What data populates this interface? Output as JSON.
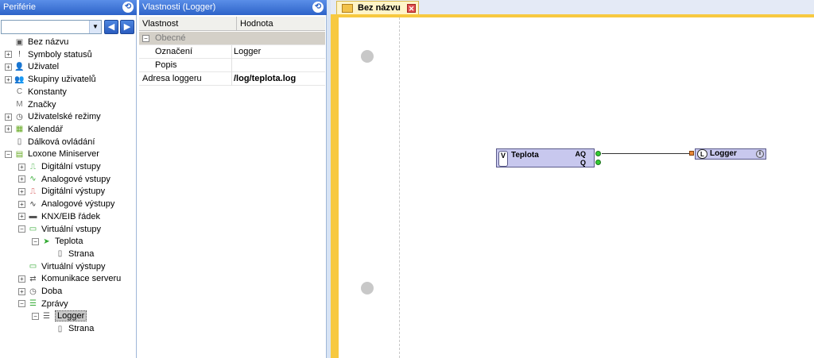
{
  "periferie": {
    "title": "Periférie",
    "tree": [
      {
        "label": "Bez názvu",
        "depth": 0,
        "expander": "",
        "icon": "page-icon",
        "glyph": "▣"
      },
      {
        "label": "Symboly statusů",
        "depth": 0,
        "expander": "+",
        "icon": "status-icon",
        "glyph": "!"
      },
      {
        "label": "Uživatel",
        "depth": 0,
        "expander": "+",
        "icon": "user-icon",
        "glyph": "👤"
      },
      {
        "label": "Skupiny uživatelů",
        "depth": 0,
        "expander": "+",
        "icon": "user-group-icon",
        "glyph": "👥"
      },
      {
        "label": "Konstanty",
        "depth": 0,
        "expander": "",
        "icon": "constant-icon",
        "glyph": "C"
      },
      {
        "label": "Značky",
        "depth": 0,
        "expander": "",
        "icon": "marker-icon",
        "glyph": "M"
      },
      {
        "label": "Uživatelské režimy",
        "depth": 0,
        "expander": "+",
        "icon": "clock-icon",
        "glyph": "◷"
      },
      {
        "label": "Kalendář",
        "depth": 0,
        "expander": "+",
        "icon": "calendar-icon",
        "glyph": "▦"
      },
      {
        "label": "Dálková ovládání",
        "depth": 0,
        "expander": "",
        "icon": "remote-icon",
        "glyph": "▯"
      },
      {
        "label": "Loxone Miniserver",
        "depth": 0,
        "expander": "−",
        "icon": "miniserver-icon",
        "glyph": "▤"
      },
      {
        "label": "Digitální vstupy",
        "depth": 1,
        "expander": "+",
        "icon": "digital-input-icon",
        "glyph": "⎍"
      },
      {
        "label": "Analogové vstupy",
        "depth": 1,
        "expander": "+",
        "icon": "analog-input-icon",
        "glyph": "∿"
      },
      {
        "label": "Digitální výstupy",
        "depth": 1,
        "expander": "+",
        "icon": "digital-output-icon",
        "glyph": "⎍"
      },
      {
        "label": "Analogové výstupy",
        "depth": 1,
        "expander": "+",
        "icon": "analog-output-icon",
        "glyph": "∿"
      },
      {
        "label": "KNX/EIB řádek",
        "depth": 1,
        "expander": "+",
        "icon": "knx-icon",
        "glyph": "▬"
      },
      {
        "label": "Virtuální vstupy",
        "depth": 1,
        "expander": "−",
        "icon": "virtual-input-icon",
        "glyph": "▭"
      },
      {
        "label": "Teplota",
        "depth": 2,
        "expander": "−",
        "icon": "teplota-icon",
        "glyph": "➤"
      },
      {
        "label": "Strana",
        "depth": 3,
        "expander": "",
        "icon": "page-icon",
        "glyph": "▯"
      },
      {
        "label": "Virtuální výstupy",
        "depth": 1,
        "expander": "",
        "icon": "virtual-output-icon",
        "glyph": "▭"
      },
      {
        "label": "Komunikace serveru",
        "depth": 1,
        "expander": "+",
        "icon": "server-comm-icon",
        "glyph": "⇄"
      },
      {
        "label": "Doba",
        "depth": 1,
        "expander": "+",
        "icon": "time-icon",
        "glyph": "◷"
      },
      {
        "label": "Zprávy",
        "depth": 1,
        "expander": "−",
        "icon": "messages-icon",
        "glyph": "☰"
      },
      {
        "label": "Logger",
        "depth": 2,
        "expander": "−",
        "icon": "logger-icon",
        "glyph": "☰",
        "selected": true
      },
      {
        "label": "Strana",
        "depth": 3,
        "expander": "",
        "icon": "page-icon",
        "glyph": "▯"
      }
    ]
  },
  "vlastnosti": {
    "title": "Vlastnosti (Logger)",
    "col_property": "Vlastnost",
    "col_value": "Hodnota",
    "category": "Obecné",
    "rows": [
      {
        "key": "Označení",
        "value": "Logger"
      },
      {
        "key": "Popis",
        "value": ""
      },
      {
        "key": "Adresa loggeru",
        "value": "/log/teplota.log",
        "bold": true
      }
    ]
  },
  "editor": {
    "tab_label": "Bez názvu",
    "block_input": {
      "tag": "V",
      "name": "Teplota",
      "port_aq": "AQ",
      "port_q": "Q"
    },
    "block_logger": {
      "tag": "L",
      "name": "Logger"
    }
  }
}
